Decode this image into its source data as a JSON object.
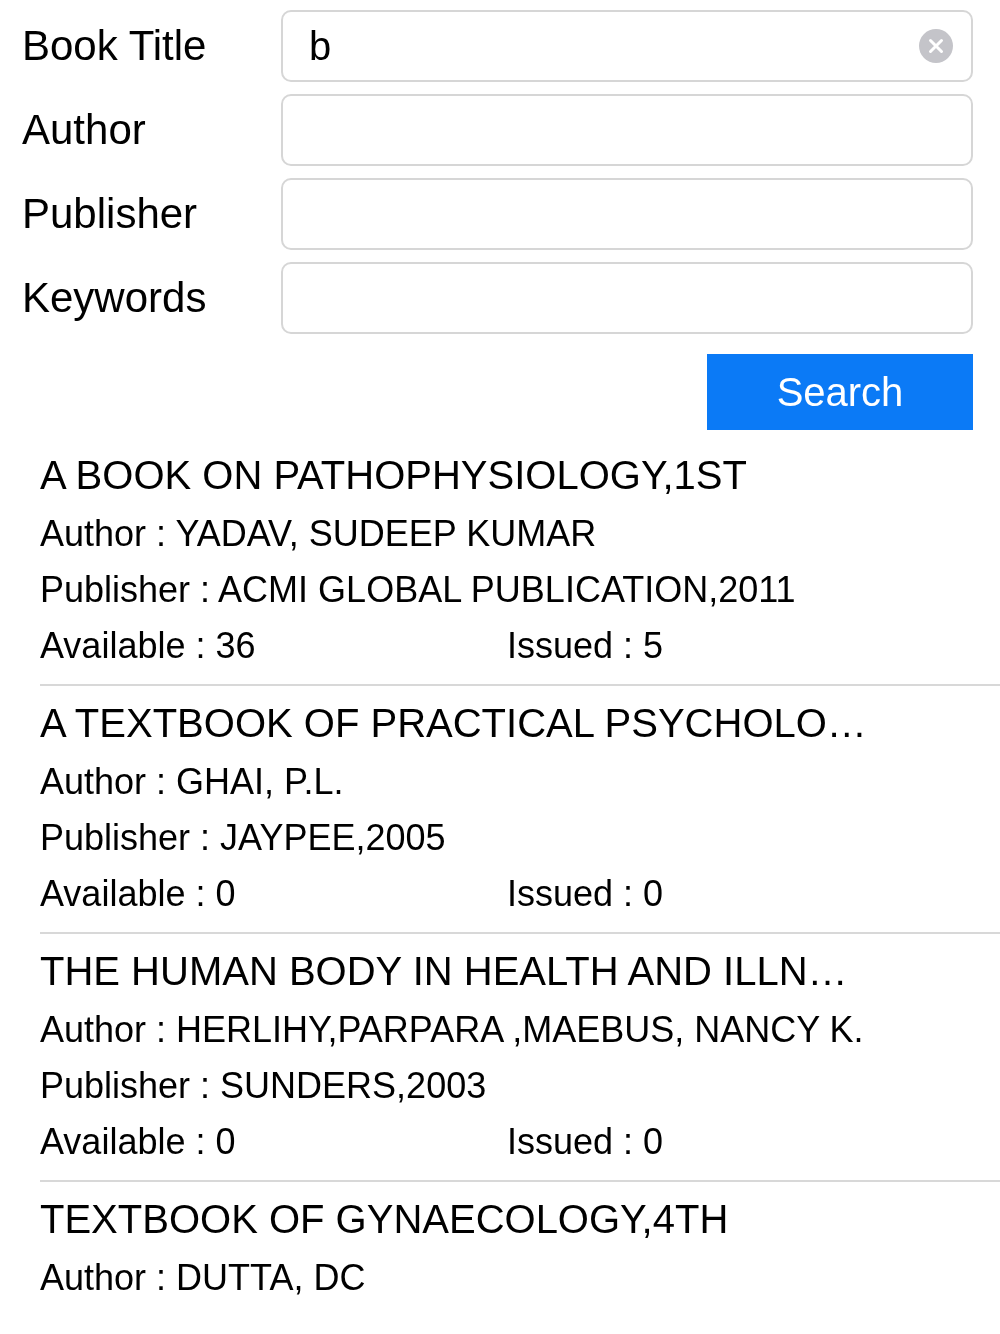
{
  "form": {
    "fields": [
      {
        "label": "Book Title",
        "value": "b",
        "clear_button": true
      },
      {
        "label": "Author",
        "clear_button": false
      },
      {
        "label": "Publisher",
        "clear_button": false
      },
      {
        "label": "Keywords",
        "clear_button": false
      }
    ]
  },
  "search_button": {
    "label": "Search"
  },
  "results": [
    {
      "title": "A BOOK ON PATHOPHYSIOLOGY,1ST",
      "author": "Author : YADAV, SUDEEP KUMAR",
      "publisher": "Publisher : ACMI GLOBAL PUBLICATION,2011",
      "available": "Available : 36",
      "issued": "Issued : 5"
    },
    {
      "title": "A TEXTBOOK OF PRACTICAL PSYCHOLO…",
      "author": "Author : GHAI, P.L.",
      "publisher": "Publisher : JAYPEE,2005",
      "available": "Available : 0",
      "issued": "Issued : 0"
    },
    {
      "title": "THE HUMAN BODY IN HEALTH AND ILLN…",
      "author": "Author : HERLIHY,PARPARA ,MAEBUS, NANCY K.",
      "publisher": "Publisher : SUNDERS,2003",
      "available": "Available : 0",
      "issued": "Issued : 0"
    },
    {
      "title": "TEXTBOOK OF GYNAECOLOGY,4TH",
      "author": "Author : DUTTA, DC"
    }
  ]
}
